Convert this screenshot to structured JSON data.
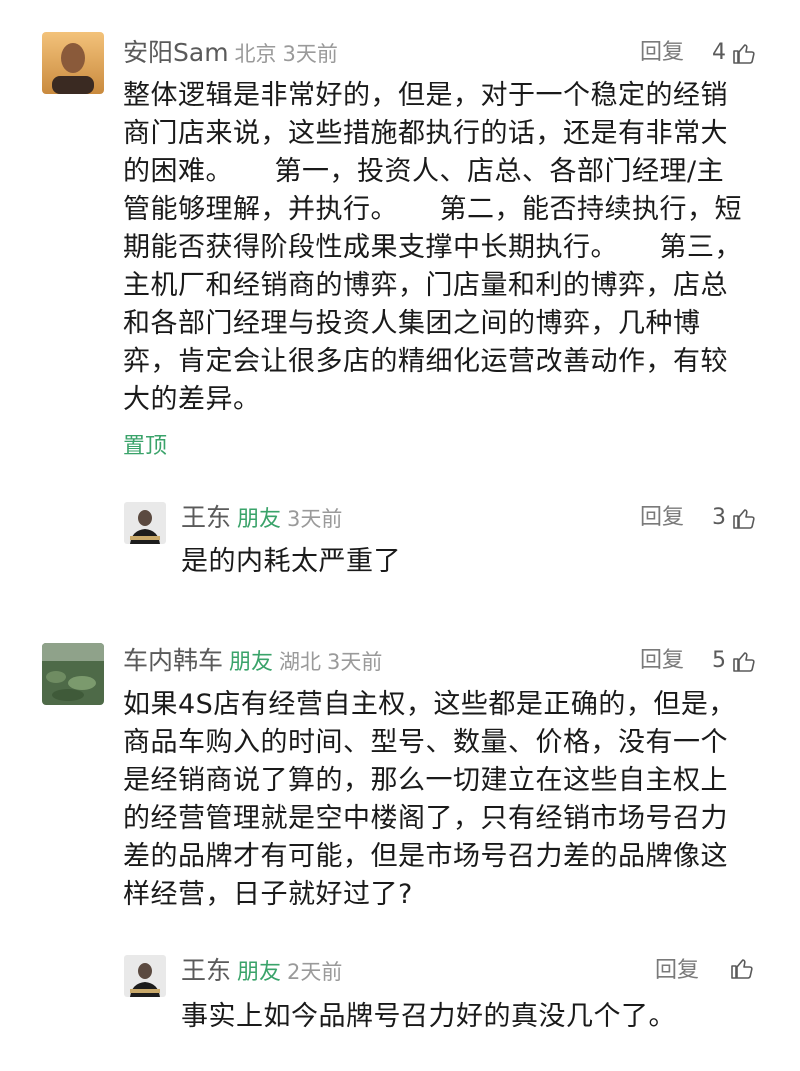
{
  "comments": [
    {
      "author": "安阳Sam",
      "location": "北京",
      "time": "3天前",
      "reply_label": "回复",
      "likes": "4",
      "text": "整体逻辑是非常好的，但是，对于一个稳定的经销\n商门店来说，这些措施都执行的话，还是有非常大\n的困难。　　第一，投资人、店总、各部门经理/主\n管能够理解，并执行。　　第二，能否持续执行，短\n期能否获得阶段性成果支撑中长期执行。　　第三，\n主机厂和经销商的博弈，门店量和利的博弈，店总\n和各部门经理与投资人集团之间的博弈，几种博\n弈，肯定会让很多店的精细化运营改善动作，有较\n大的差异。",
      "pin_label": "置顶",
      "reply": {
        "author": "王东",
        "friend": "朋友",
        "time": "3天前",
        "reply_label": "回复",
        "likes": "3",
        "text": "是的内耗太严重了"
      }
    },
    {
      "author": "车内韩车",
      "friend": "朋友",
      "location": "湖北",
      "time": "3天前",
      "reply_label": "回复",
      "likes": "5",
      "text": "如果4S店有经营自主权，这些都是正确的，但是，\n商品车购入的时间、型号、数量、价格，没有一个\n是经销商说了算的，那么一切建立在这些自主权上\n的经营管理就是空中楼阁了，只有经销市场号召力\n差的品牌才有可能，但是市场号召力差的品牌像这\n样经营，日子就好过了?",
      "reply": {
        "author": "王东",
        "friend": "朋友",
        "time": "2天前",
        "reply_label": "回复",
        "text": "事实上如今品牌号召力好的真没几个了。"
      }
    }
  ],
  "colors": {
    "friend": "#3aa36a",
    "meta": "#9a9a9a",
    "text": "#1a1a1a"
  },
  "icons": {
    "like": "thumbs-up-icon"
  }
}
